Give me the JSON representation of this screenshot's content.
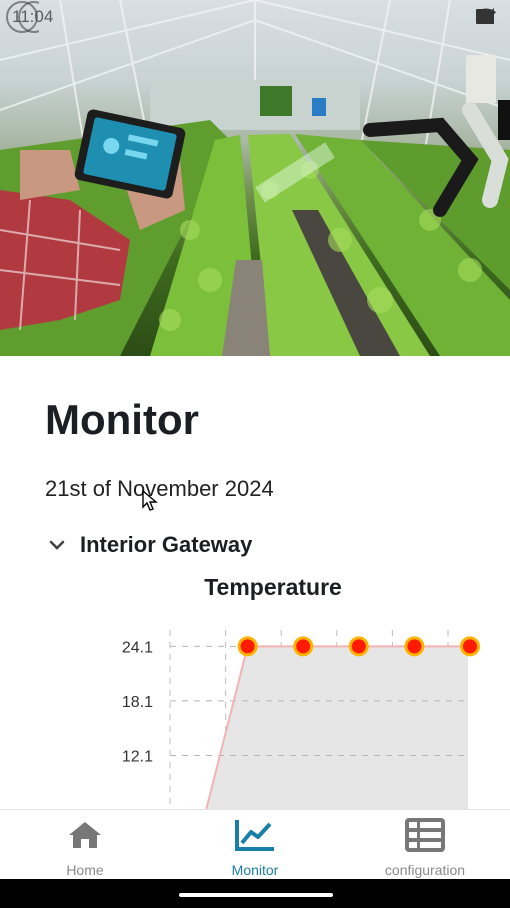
{
  "status_bar": {
    "time": "11:04"
  },
  "hero": {
    "image_description_icon": "greenhouse-hero-image"
  },
  "main": {
    "title": "Monitor",
    "date": "21st of November 2024",
    "gateway": {
      "label": "Interior Gateway",
      "icon": "chevron-down-icon",
      "expanded": true
    }
  },
  "chart_data": {
    "type": "area",
    "title": "Temperature",
    "y_ticks": [
      "24.1",
      "18.1",
      "12.1"
    ],
    "x": [
      0,
      1,
      2,
      3,
      4,
      5
    ],
    "values": [
      0,
      24.1,
      24.1,
      24.1,
      24.1,
      24.1
    ],
    "ylim": [
      6.1,
      27
    ],
    "grid": true,
    "colors": {
      "line": "#f3b3b3",
      "fill": "#e6e6e6",
      "point": "#ff1a00",
      "point_ring": "#ffb300"
    }
  },
  "bottom_nav": {
    "items": [
      {
        "label": "Home",
        "icon": "home-icon",
        "active": false
      },
      {
        "label": "Monitor",
        "icon": "chart-line-icon",
        "active": true
      },
      {
        "label": "configuration",
        "icon": "list-table-icon",
        "active": false
      }
    ],
    "accent": "#1a7fa8",
    "inactive": "#8a8a8a"
  }
}
